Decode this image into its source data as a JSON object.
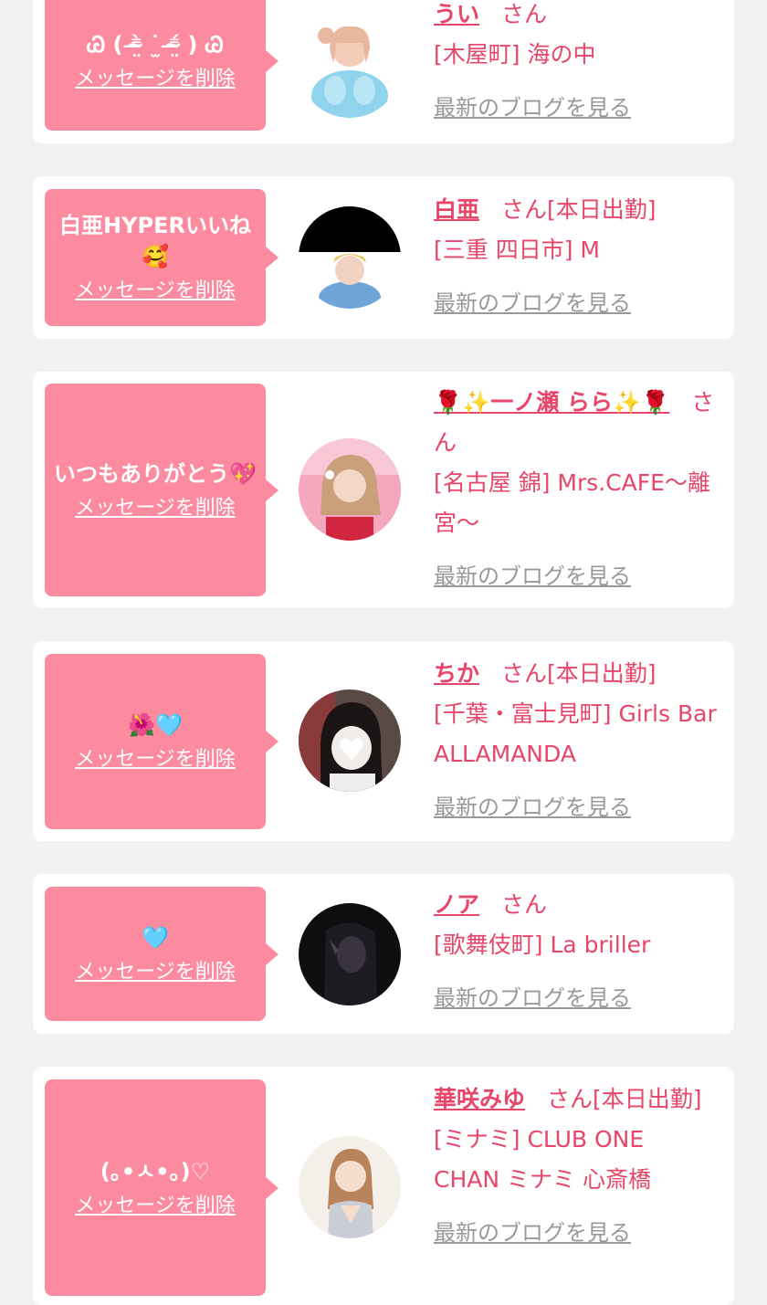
{
  "colors": {
    "page_bg": "#f2f2f2",
    "card_bg": "#ffffff",
    "bubble": "#fc8ba0",
    "accent_text": "#e8456a",
    "link_gray": "#999999"
  },
  "items": [
    {
      "message": "Ꮚ ( ⁼̴̶̤̀ ˙̫ ⁼̴̶̤́ ) Ꮚ",
      "delete_label": "メッセージを削除",
      "name": "うい",
      "san": "さん",
      "shift": "",
      "shop": "[木屋町] 海の中",
      "blog_link": "最新のブログを見る",
      "avatar_icon": "profile-photo"
    },
    {
      "message": "白亜HYPERいいね🥰",
      "delete_label": "メッセージを削除",
      "name": "白亜",
      "san": "さん",
      "shift": "[本日出勤]",
      "shop": "[三重 四日市] M",
      "blog_link": "最新のブログを見る",
      "avatar_icon": "profile-photo"
    },
    {
      "message": "いつもありがとう💖",
      "delete_label": "メッセージを削除",
      "name": "🌹✨一ノ瀬 らら✨🌹",
      "san": "さん",
      "shift": "",
      "shop": "[名古屋 錦] Mrs.CAFE〜離宮〜",
      "blog_link": "最新のブログを見る",
      "avatar_icon": "profile-photo"
    },
    {
      "message": "🌺🩵",
      "delete_label": "メッセージを削除",
      "name": "ちか",
      "san": "さん",
      "shift": "[本日出勤]",
      "shop": "[千葉・富士見町] Girls Bar ALLAMANDA",
      "blog_link": "最新のブログを見る",
      "avatar_icon": "profile-photo"
    },
    {
      "message": "🩵",
      "delete_label": "メッセージを削除",
      "name": "ノア",
      "san": "さん",
      "shift": "",
      "shop": "[歌舞伎町] La briller",
      "blog_link": "最新のブログを見る",
      "avatar_icon": "profile-photo"
    },
    {
      "message": "(｡•ㅅ•｡)♡",
      "delete_label": "メッセージを削除",
      "name": "華咲みゆ",
      "san": "さん",
      "shift": "[本日出勤]",
      "shop": "[ミナミ] CLUB ONE CHAN ミナミ 心斎橋",
      "blog_link": "最新のブログを見る",
      "avatar_icon": "profile-photo"
    }
  ]
}
